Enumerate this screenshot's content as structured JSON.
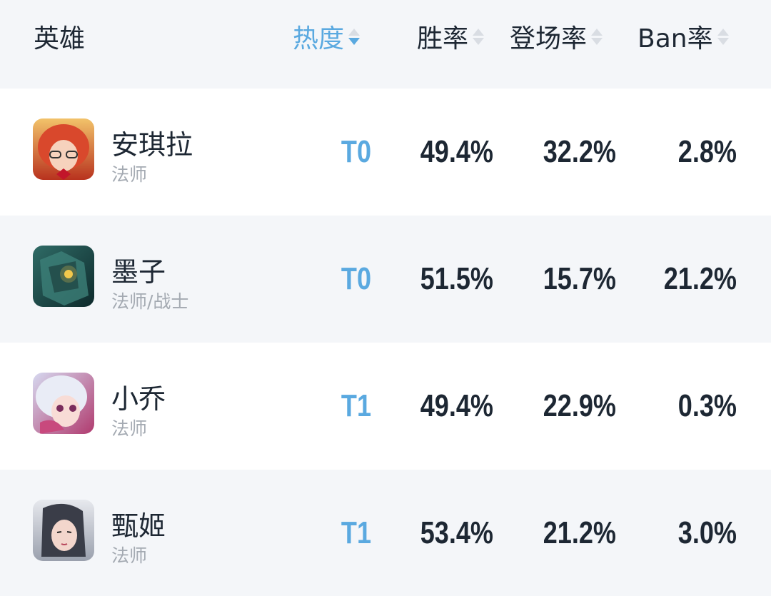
{
  "header": {
    "hero": "英雄",
    "heat": "热度",
    "win_rate": "胜率",
    "pick_rate": "登场率",
    "ban_rate": "Ban率"
  },
  "sort": {
    "active_column": "heat",
    "direction": "descending"
  },
  "colors": {
    "accent": "#5aa9e0",
    "text": "#1d2733",
    "muted": "#a4aab2"
  },
  "rows": [
    {
      "name": "安琪拉",
      "role": "法师",
      "tier": "T0",
      "win_rate": "49.4%",
      "pick_rate": "32.2%",
      "ban_rate": "2.8%"
    },
    {
      "name": "墨子",
      "role": "法师/战士",
      "tier": "T0",
      "win_rate": "51.5%",
      "pick_rate": "15.7%",
      "ban_rate": "21.2%"
    },
    {
      "name": "小乔",
      "role": "法师",
      "tier": "T1",
      "win_rate": "49.4%",
      "pick_rate": "22.9%",
      "ban_rate": "0.3%"
    },
    {
      "name": "甄姬",
      "role": "法师",
      "tier": "T1",
      "win_rate": "53.4%",
      "pick_rate": "21.2%",
      "ban_rate": "3.0%"
    }
  ]
}
